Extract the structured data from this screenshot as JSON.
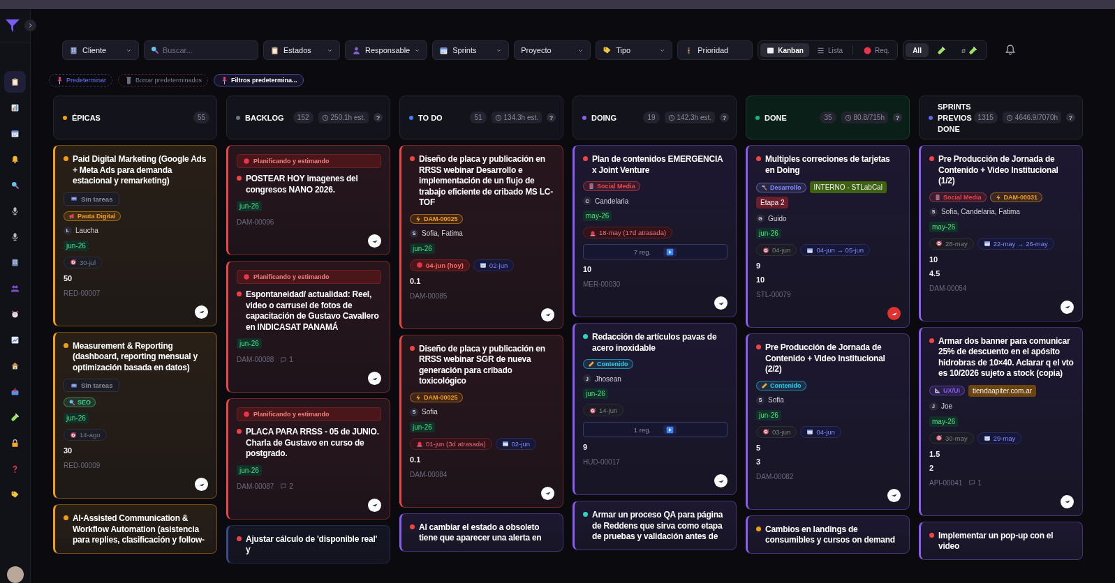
{
  "sidebar": {
    "items": [
      {
        "selected": true
      },
      {
        "selected": false
      },
      {
        "selected": false
      },
      {
        "selected": false
      },
      {
        "selected": false
      },
      {
        "selected": false
      },
      {
        "selected": false
      },
      {
        "selected": false
      },
      {
        "selected": false
      },
      {
        "selected": false
      },
      {
        "selected": false
      },
      {
        "selected": false
      },
      {
        "selected": false
      },
      {
        "selected": false
      },
      {
        "selected": false
      },
      {
        "selected": false
      },
      {
        "selected": false
      }
    ]
  },
  "filters": [
    {
      "label": "Cliente",
      "kind": "dropdown"
    },
    {
      "placeholder": "Buscar...",
      "kind": "search"
    },
    {
      "label": "Estados",
      "kind": "dropdown"
    },
    {
      "label": "Responsable",
      "kind": "dropdown"
    },
    {
      "label": "Sprints",
      "kind": "dropdown"
    },
    {
      "label": "Proyecto",
      "kind": "dropdown"
    },
    {
      "label": "Tipo",
      "kind": "dropdown"
    },
    {
      "label": "Prioridad",
      "kind": "button"
    }
  ],
  "views": [
    {
      "label": "Kanban",
      "selected": true
    },
    {
      "label": "Lista",
      "selected": false
    },
    {
      "label": "Req.",
      "selected": false
    }
  ],
  "modes": [
    {
      "label": "All",
      "selected": true
    },
    {
      "selected": false
    },
    {
      "label": "ø",
      "selected": false
    }
  ],
  "chips": [
    {
      "label": "Predeterminar",
      "kind": "set"
    },
    {
      "label": "Borrar predeterminados",
      "kind": "clear"
    },
    {
      "label": "Filtros predetermina...",
      "kind": "active"
    }
  ],
  "columns": [
    {
      "title": "ÉPICAS",
      "color": "#f59e0b",
      "count": "55",
      "tinted": false,
      "cards": [
        {
          "color": "#f59e0b",
          "dot": {
            "color": "#f59e0b"
          },
          "title": "Paid Digital Marketing (Google Ads + Meta Ads para demanda estacional y remarketing)",
          "tasks": "Sin tareas",
          "tags": [
            {
              "text": "Pauta Digital",
              "kind": "marketing",
              "color": "#f59e0b"
            }
          ],
          "person": {
            "initial": "L",
            "names": "Laucha"
          },
          "sprint": "jun-26",
          "dates": [
            {
              "text": "30-jul",
              "kind": "target"
            }
          ],
          "numbers": [
            "50"
          ],
          "id": "RED-00007",
          "logo": {
            "color": "#ffffff"
          }
        },
        {
          "color": "#f59e0b",
          "dot": {
            "color": "#f59e0b"
          },
          "title": "Measurement & Reporting (dashboard, reporting mensual y optimización basada en datos)",
          "tasks": "Sin tareas",
          "tags": [
            {
              "text": "SEO",
              "kind": "seo",
              "color": "#34d399"
            }
          ],
          "sprint": "jun-26",
          "dates": [
            {
              "text": "14-ago",
              "kind": "target"
            }
          ],
          "numbers": [
            "30"
          ],
          "id": "RED-00009",
          "logo": {
            "color": "#ffffff"
          }
        },
        {
          "color": "#f59e0b",
          "dot": {
            "color": "#f59e0b"
          },
          "title": "AI-Assisted Communication & Workflow Automation (asistencia para replies, clasificación y follow-"
        }
      ]
    },
    {
      "title": "BACKLOG",
      "color": "#6b7280",
      "count": "152",
      "estimate": "250.1h est.",
      "help": "?",
      "tinted": false,
      "cards": [
        {
          "color": "#ef4444",
          "status": "Planificando y estimando",
          "dot": {
            "color": "#ef4444"
          },
          "title": "POSTEAR HOY imagenes del congresos NANO 2026.",
          "sprint": "jun-26",
          "id": "DAM-00096",
          "logo": {
            "color": "#ffffff"
          }
        },
        {
          "color": "#ef4444",
          "status": "Planificando y estimando",
          "dot": {
            "color": "#ef4444"
          },
          "title": "Espontaneidad/ actualidad: Reel, video o carrusel de fotos de capacitación de Gustavo Cavallero en INDICASAT PANAMÁ",
          "sprint": "jun-26",
          "id": "DAM-00088",
          "comments": "1",
          "logo": {
            "color": "#ffffff"
          }
        },
        {
          "color": "#ef4444",
          "status": "Planificando y estimando",
          "dot": {
            "color": "#ef4444"
          },
          "title": "PLACA PARA RRSS - 05 de JUNIO. Charla de Gustavo en curso de postgrado.",
          "sprint": "jun-26",
          "id": "DAM-00087",
          "comments": "2",
          "logo": {
            "color": "#ffffff"
          }
        },
        {
          "color": "#3b4a8a",
          "dot": {
            "color": "#ef4444"
          },
          "title": "Ajustar cálculo de 'disponible real' y"
        }
      ]
    },
    {
      "title": "TO DO",
      "color": "#3b82f6",
      "count": "51",
      "estimate": "134.3h est.",
      "help": "?",
      "tinted": false,
      "cards": [
        {
          "color": "#ef4444",
          "dot": {
            "color": "#ef4444"
          },
          "title": "Diseño de placa y publicación en RRSS webinar Desarrollo e implementación de un flujo de trabajo eficiente de cribado MS LC-TOF",
          "tags": [
            {
              "text": "DAM-00025",
              "kind": "parent",
              "color": "#f59e0b"
            }
          ],
          "person": {
            "initial": "S",
            "names": "Sofia, Fatima"
          },
          "sprint": "jun-26",
          "dates": [
            {
              "text": "04-jun (hoy)",
              "kind": "today"
            },
            {
              "text": "02-jun",
              "kind": "calendar"
            }
          ],
          "numbers": [
            "0.1"
          ],
          "id": "DAM-00085",
          "logo": {
            "color": "#ffffff"
          }
        },
        {
          "color": "#ef4444",
          "dot": {
            "color": "#ef4444"
          },
          "title": "Diseño de placa y publicación en RRSS webinar SGR de nueva generación para cribado toxicológico",
          "tags": [
            {
              "text": "DAM-00025",
              "kind": "parent",
              "color": "#f59e0b"
            }
          ],
          "person": {
            "initial": "S",
            "names": "Sofia"
          },
          "sprint": "jun-26",
          "dates": [
            {
              "text": "01-jun (3d atrasada)",
              "kind": "overdue"
            },
            {
              "text": "02-jun",
              "kind": "calendar"
            }
          ],
          "numbers": [
            "0.1"
          ],
          "id": "DAM-00084",
          "logo": {
            "color": "#ffffff"
          }
        },
        {
          "color": "#8b5cf6",
          "dot": {
            "color": "#ef4444"
          },
          "title": "Al cambiar el estado a obsoleto tiene que aparecer una alerta en"
        }
      ]
    },
    {
      "title": "DOING",
      "color": "#8b5cf6",
      "count": "19",
      "estimate": "142.3h est.",
      "help": "?",
      "tinted": false,
      "cards": [
        {
          "color": "#8b5cf6",
          "dot": {
            "color": "#ef4444"
          },
          "title": "Plan de contenidos EMERGENCIA x Joint Venture",
          "tags": [
            {
              "text": "Social Media",
              "kind": "social",
              "color": "#ef4444"
            }
          ],
          "person": {
            "initial": "C",
            "names": "Candelaria"
          },
          "sprint": "may-26",
          "dates": [
            {
              "text": "18-may (17d atrasada)",
              "kind": "overdue"
            }
          ],
          "records": "7 reg.",
          "numbers": [
            "10"
          ],
          "id": "MER-00030",
          "logo": {
            "color": "#ffffff"
          }
        },
        {
          "color": "#8b5cf6",
          "dot": {
            "color": "#2dd4bf"
          },
          "title": "Redacción de artículos pavas de acero inoxidable",
          "tags": [
            {
              "text": "Contenido",
              "kind": "content",
              "color": "#22d3ee"
            }
          ],
          "person": {
            "initial": "J",
            "names": "Jhosean"
          },
          "sprint": "jun-26",
          "dates": [
            {
              "text": "14-jun",
              "kind": "target"
            }
          ],
          "records": "1 reg.",
          "numbers": [
            "9"
          ],
          "id": "HUD-00017",
          "logo": {
            "color": "#ffffff"
          }
        },
        {
          "color": "#8b5cf6",
          "dot": {
            "color": "#2dd4bf"
          },
          "title": "Armar un proceso QA para página de Reddens que sirva como etapa de pruebas y validación antes de"
        }
      ]
    },
    {
      "title": "DONE",
      "color": "#10b981",
      "count": "35",
      "estimate": "80.8/715h",
      "help": "?",
      "tinted": true,
      "cards": [
        {
          "color": "#8b5cf6",
          "dot": {
            "color": "#ef4444"
          },
          "title": "Multiples correciones de tarjetas en Doing",
          "tags": [
            {
              "text": "Desarrollo",
              "kind": "dev",
              "color": "#818cf8"
            },
            {
              "text": "INTERNO - STLabCal",
              "kind": "client",
              "color": "#3f6212"
            },
            {
              "text": "Etapa 2",
              "kind": "stage",
              "color": "#6b1d2c"
            }
          ],
          "person": {
            "initial": "G",
            "names": "Guido"
          },
          "sprint": "jun-26",
          "dates": [
            {
              "text": "04-jun",
              "kind": "target"
            },
            {
              "text": "04-jun → 05-jun",
              "kind": "calendar"
            }
          ],
          "numbers": [
            "9",
            "10"
          ],
          "id": "STL-00079",
          "logo": {
            "color": "#e0322f"
          }
        },
        {
          "color": "#8b5cf6",
          "dot": {
            "color": "#ef4444"
          },
          "title": "Pre Producción de Jornada de Contenido + Video Institucional (2/2)",
          "tags": [
            {
              "text": "Contenido",
              "kind": "content",
              "color": "#22d3ee"
            }
          ],
          "person": {
            "initial": "S",
            "names": "Sofia"
          },
          "sprint": "jun-26",
          "dates": [
            {
              "text": "03-jun",
              "kind": "target"
            },
            {
              "text": "04-jun",
              "kind": "calendar"
            }
          ],
          "numbers": [
            "5",
            "3"
          ],
          "id": "DAM-00082",
          "logo": {
            "color": "#ffffff"
          }
        },
        {
          "color": "#8b5cf6",
          "dot": {
            "color": "#f59e0b"
          },
          "title": "Cambios en landings de consumibles y cursos on demand"
        }
      ]
    },
    {
      "title": "SPRINTS PREVIOS DONE",
      "color": "#6366f1",
      "count": "1315",
      "estimate": "4646.9/7070h",
      "help": "?",
      "tinted": false,
      "cards": [
        {
          "color": "#8b5cf6",
          "dot": {
            "color": "#ef4444"
          },
          "title": "Pre Producción de Jornada de Contenido + Video Institucional (1/2)",
          "tags": [
            {
              "text": "Social Media",
              "kind": "social",
              "color": "#ef4444"
            },
            {
              "text": "DAM-00031",
              "kind": "parent",
              "color": "#f59e0b"
            }
          ],
          "person": {
            "initial": "S",
            "names": "Sofia, Candelaria, Fatima"
          },
          "sprint": "may-26",
          "dates": [
            {
              "text": "28-may",
              "kind": "target"
            },
            {
              "text": "22-may → 26-may",
              "kind": "calendar"
            }
          ],
          "numbers": [
            "10",
            "4.5"
          ],
          "id": "DAM-00054",
          "logo": {
            "color": "#ffffff"
          }
        },
        {
          "color": "#8b5cf6",
          "dot": {
            "color": "#ef4444"
          },
          "title": "Armar dos banner para comunicar 25% de descuento en el apósito hidrobras de 10×40. Aclarar q el vto es 10/2026 sujeto a stock (copia)",
          "tags": [
            {
              "text": "UX/UI",
              "kind": "design",
              "color": "#8b5cf6"
            },
            {
              "text": "tiendaapiter.com.ar",
              "kind": "client",
              "color": "#6b4410"
            }
          ],
          "person": {
            "initial": "J",
            "names": "Joe"
          },
          "sprint": "may-26",
          "dates": [
            {
              "text": "30-may",
              "kind": "target"
            },
            {
              "text": "29-may",
              "kind": "calendar"
            }
          ],
          "numbers": [
            "1.5",
            "2"
          ],
          "id": "API-00041",
          "comments": "1",
          "logo": {
            "color": "#ffffff"
          }
        },
        {
          "color": "#8b5cf6",
          "dot": {
            "color": "#ef4444"
          },
          "title": "Implementar un pop-up con el video"
        }
      ]
    }
  ]
}
